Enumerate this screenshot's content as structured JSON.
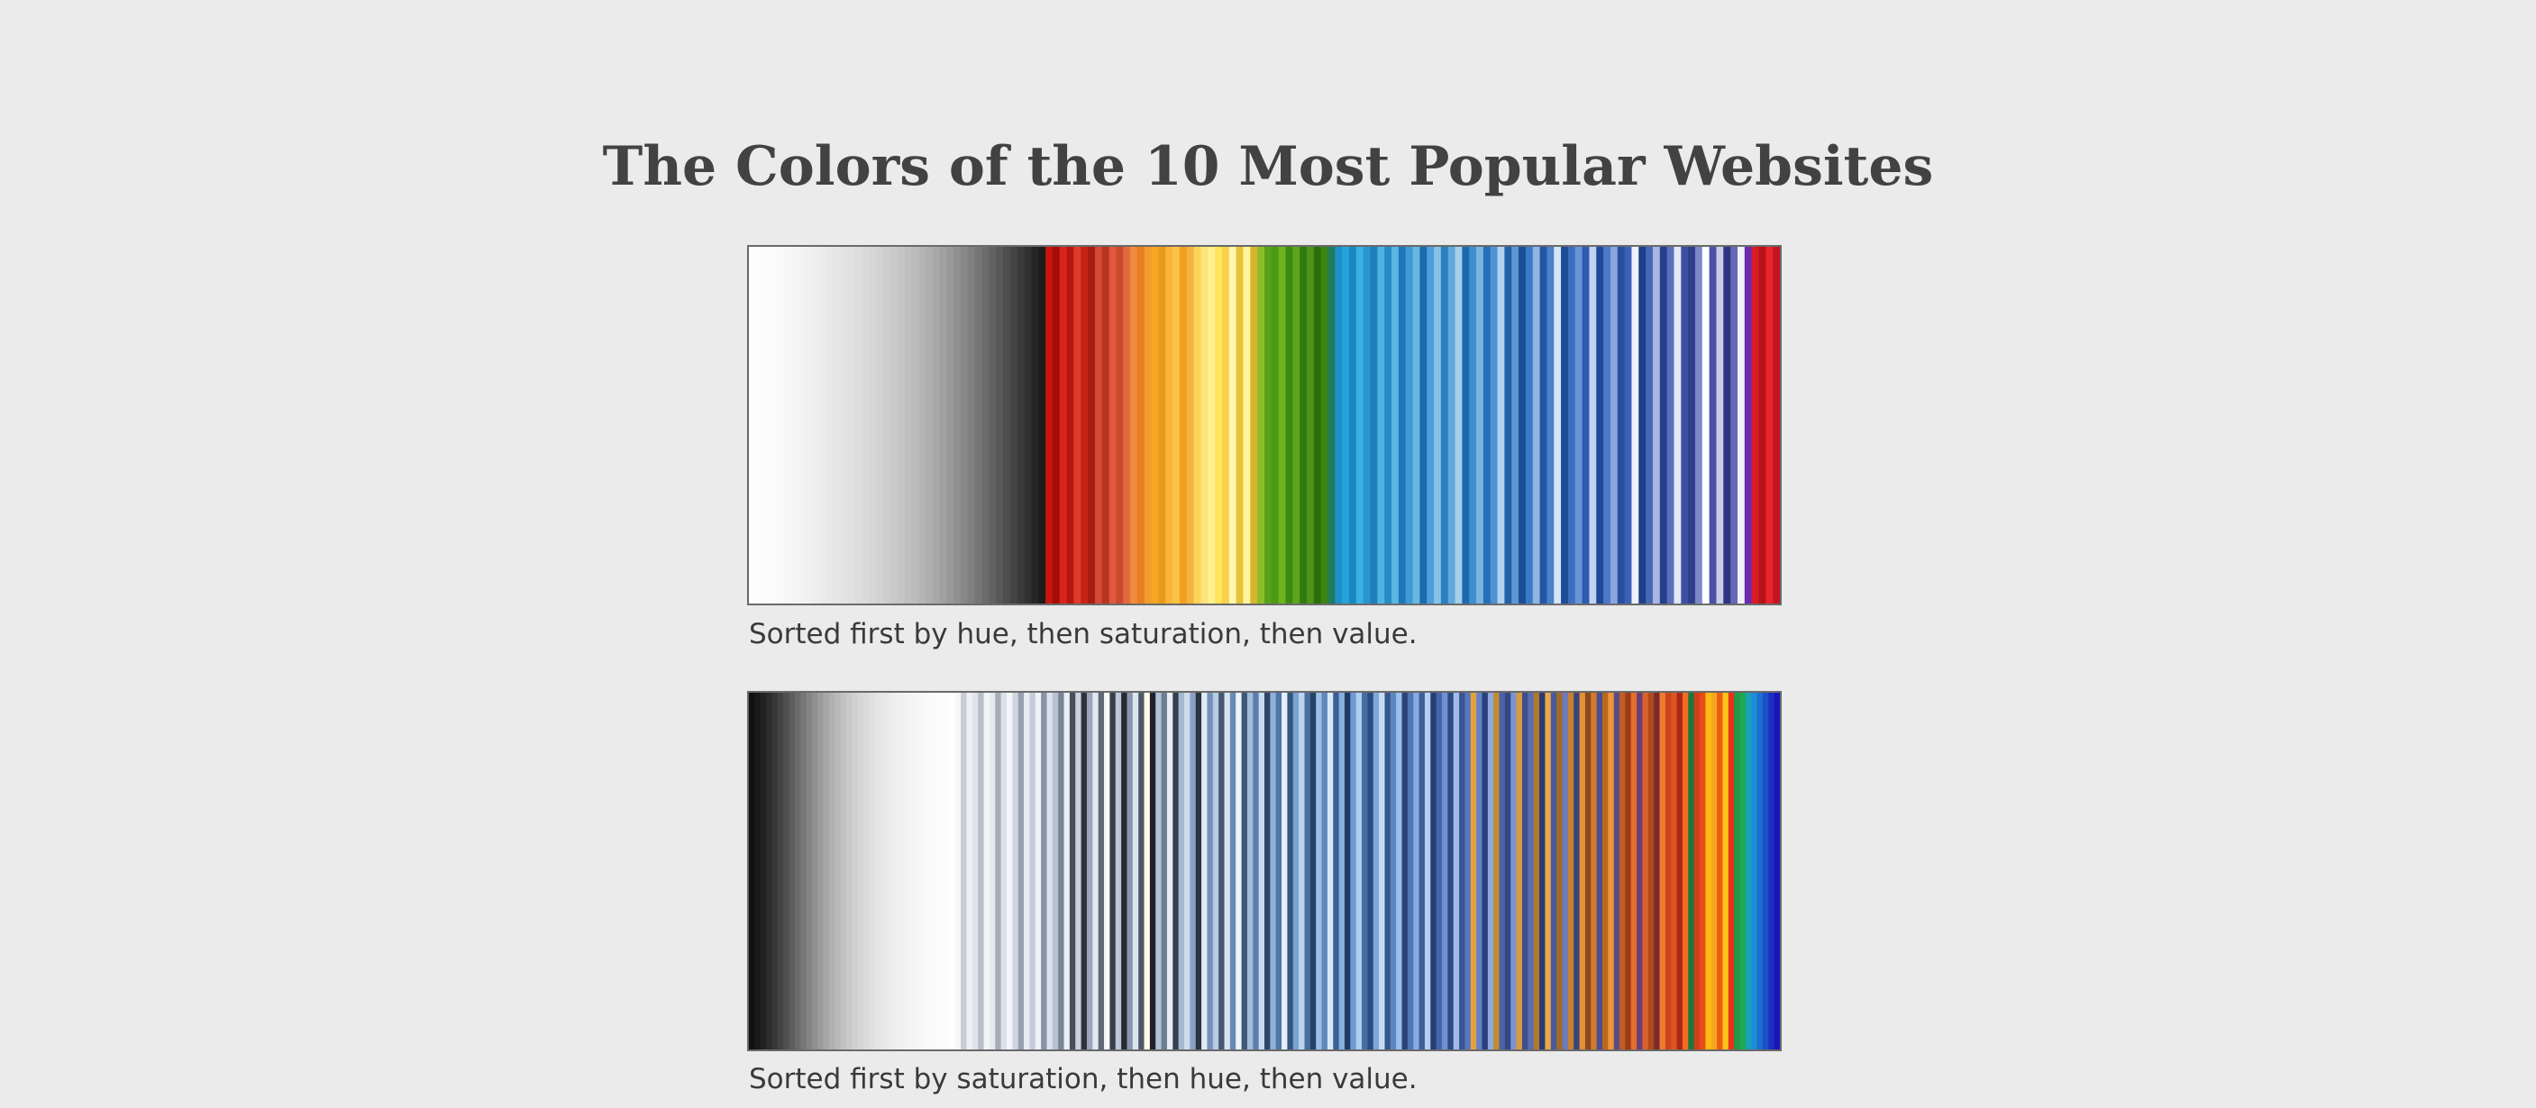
{
  "page": {
    "title": "The Colors of the 10 Most Popular Websites",
    "background_color": "#ebebeb"
  },
  "strips": [
    {
      "id": "hue",
      "caption": "Sorted first by hue, then saturation, then value.",
      "colors": [
        "#fefefe",
        "#fdfdfd",
        "#fcfcfc",
        "#fbfbfb",
        "#f9f9f9",
        "#f7f7f7",
        "#f5f5f5",
        "#f3f3f3",
        "#f1f1f1",
        "#eeeeee",
        "#ebebeb",
        "#e8e8e8",
        "#e6e6e6",
        "#e3e3e3",
        "#e0e0e0",
        "#dddddd",
        "#dadada",
        "#d6d6d6",
        "#d2d2d2",
        "#cecece",
        "#cacaca",
        "#c5c5c5",
        "#c0c0c0",
        "#bbbbbb",
        "#b5b5b5",
        "#afafaf",
        "#a8a8a8",
        "#a1a1a1",
        "#999999",
        "#919191",
        "#888888",
        "#7f7f7f",
        "#767676",
        "#6c6c6c",
        "#626262",
        "#585858",
        "#4e4e4e",
        "#444444",
        "#3a3a3a",
        "#303030",
        "#262626",
        "#1c1c1c",
        "#c8150f",
        "#a30d0a",
        "#d8251c",
        "#b7160f",
        "#e03a2a",
        "#c42417",
        "#a91c12",
        "#d34a36",
        "#b83322",
        "#e2583e",
        "#c94b2f",
        "#e06a3e",
        "#f08a3c",
        "#e67e22",
        "#f39c2f",
        "#f5a623",
        "#e89a1a",
        "#f7b63b",
        "#fbc346",
        "#f0a01e",
        "#f5b440",
        "#fcd45a",
        "#fde57a",
        "#fff08f",
        "#ffe45c",
        "#f6d24b",
        "#fff6b0",
        "#e7c33b",
        "#fff3a0",
        "#d9b52e",
        "#8cbd2a",
        "#5aa11b",
        "#4b9a14",
        "#6fb323",
        "#3d8a10",
        "#5ea51e",
        "#2f7a0d",
        "#4c9318",
        "#2b6e0a",
        "#3a8415",
        "#217a5a",
        "#1d8fc9",
        "#27a3dc",
        "#1a86c2",
        "#3bb0e3",
        "#2c95cf",
        "#1e7fbd",
        "#4fb3e2",
        "#2a8ac8",
        "#5ab6e4",
        "#1f76b8",
        "#3d9ad6",
        "#6ab7e1",
        "#1b6cad",
        "#4c9fd8",
        "#87c2e6",
        "#2c7fc3",
        "#5ea8dc",
        "#a5cfea",
        "#1e69ad",
        "#3f8fd0",
        "#7bb4e0",
        "#256fb7",
        "#4d93d3",
        "#b3d2ee",
        "#2061a8",
        "#5c98d4",
        "#1a4f96",
        "#3a7ac6",
        "#8fb6e3",
        "#2456a3",
        "#4a80cc",
        "#d6e4f5",
        "#1d4b94",
        "#3c6fc0",
        "#6b94d6",
        "#2a5bb0",
        "#c2d4f0",
        "#1f4a9a",
        "#4d78c9",
        "#8aa6dd",
        "#284e9f",
        "#3a63b8",
        "#eef2fa",
        "#1c3f88",
        "#4866b6",
        "#a6b6e0",
        "#253f8a",
        "#5a70bd",
        "#e3e7f4",
        "#3c4fa0",
        "#2e3f8e",
        "#7c88c8",
        "#ffffff",
        "#4a52a6",
        "#c9cde8",
        "#2d3380",
        "#6468b5",
        "#f1f1f8",
        "#6a2bb0",
        "#d81b24",
        "#b5121a",
        "#e8232d",
        "#c41420"
      ]
    },
    {
      "id": "saturation",
      "caption": "Sorted first by saturation, then hue, then value.",
      "colors": [
        "#111111",
        "#191919",
        "#222222",
        "#2c2c2c",
        "#373737",
        "#434343",
        "#505050",
        "#5d5d5d",
        "#6a6a6a",
        "#777777",
        "#848484",
        "#909090",
        "#9b9b9b",
        "#a6a6a6",
        "#b0b0b0",
        "#b9b9b9",
        "#c2c2c2",
        "#c9c9c9",
        "#d0d0d0",
        "#d6d6d6",
        "#dbdbdb",
        "#e0e0e0",
        "#e4e4e4",
        "#e8e8e8",
        "#ebebeb",
        "#eeeeee",
        "#f0f0f0",
        "#f2f2f2",
        "#f4f4f4",
        "#f6f6f6",
        "#f8f8f8",
        "#fafafa",
        "#fbfbfb",
        "#fcfcfc",
        "#fdfdfd",
        "#ffffff",
        "#f5f6f8",
        "#c9ccd2",
        "#eef0f4",
        "#dfe3ea",
        "#b8bec8",
        "#f1f3f7",
        "#e5e9f0",
        "#a7aeba",
        "#dce2ec",
        "#f3f5f9",
        "#cfd6e2",
        "#98a1b0",
        "#e8edf5",
        "#c3ccd9",
        "#eff2f8",
        "#8a93a3",
        "#dbe2ee",
        "#b6c1d1",
        "#7b8596",
        "#eaeef6",
        "#4a4f57",
        "#c7d1e0",
        "#2e3238",
        "#9aa6b8",
        "#e2e8f2",
        "#5f6875",
        "#f5f7fb",
        "#3a4049",
        "#bcc9db",
        "#272b31",
        "#8797ad",
        "#dde5f1",
        "#4f5a69",
        "#fffde8",
        "#1f2329",
        "#b1c2d8",
        "#6d7d93",
        "#e7edf6",
        "#34404f",
        "#a5b8d1",
        "#cddbec",
        "#8aa3c3",
        "#2b3442",
        "#e2ebf6",
        "#7592b8",
        "#b7cbe3",
        "#46586f",
        "#d6e4f4",
        "#6b8ab3",
        "#f0f5fb",
        "#3f5876",
        "#a3bddd",
        "#5c7faa",
        "#c8dbf1",
        "#2d4766",
        "#8fb0d8",
        "#4f76a6",
        "#e6f0fa",
        "#37567f",
        "#7aa3d3",
        "#bdd4ee",
        "#4a6fa0",
        "#264367",
        "#9bbde6",
        "#5f88bd",
        "#d8e7f7",
        "#3a5f91",
        "#88aee0",
        "#1f3a63",
        "#6f9bd2",
        "#aecdf0",
        "#456da3",
        "#2a4c80",
        "#7ea7dc",
        "#c9dcf3",
        "#35588e",
        "#5d86c0",
        "#9cc0ea",
        "#2b4478",
        "#4f77b4",
        "#86abe0",
        "#3f5f98",
        "#b5cff0",
        "#253e72",
        "#4466a8",
        "#6f92cf",
        "#2f4a86",
        "#a0bde8",
        "#3a5596",
        "#5876bb",
        "#e3a13a",
        "#6282c6",
        "#2a3f7c",
        "#8fa8dd",
        "#c58a2e",
        "#4a62a8",
        "#334784",
        "#7d93cf",
        "#d89b3c",
        "#3c4f8f",
        "#5a6db1",
        "#b07a2a",
        "#2c3a75",
        "#e8a84a",
        "#4b5a9c",
        "#a36a25",
        "#6b7bbd",
        "#c77f30",
        "#38447f",
        "#e09035",
        "#8a4a20",
        "#d4782a",
        "#4a4f8e",
        "#b86620",
        "#f0953a",
        "#5a4b86",
        "#c15c22",
        "#9a3a1a",
        "#e2702c",
        "#6a3e7a",
        "#d8632a",
        "#b04a1c",
        "#7a2a2a",
        "#f07a2e",
        "#c8461e",
        "#e0551f",
        "#a8281a",
        "#f26b22",
        "#16793a",
        "#d43d1a",
        "#e84a18",
        "#fdbb12",
        "#f7a81a",
        "#ef5a14",
        "#fcc419",
        "#e8331a",
        "#1f9a4a",
        "#20a84e",
        "#17a2b8",
        "#1e8cd8",
        "#1b6fd0",
        "#1c4fc8",
        "#1a2fc0",
        "#1616b8"
      ]
    }
  ]
}
